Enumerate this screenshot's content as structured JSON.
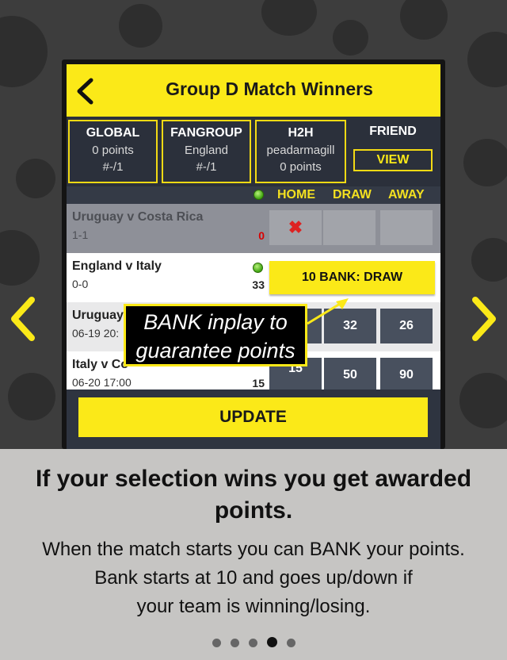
{
  "header": {
    "title": "Group D Match Winners"
  },
  "stats": [
    {
      "title": "GLOBAL",
      "line1": "0 points",
      "line2": "#-/1"
    },
    {
      "title": "FANGROUP",
      "line1": "England",
      "line2": "#-/1"
    },
    {
      "title": "H2H",
      "line1": "peadarmagill",
      "line2": "0 points"
    }
  ],
  "friend": {
    "title": "FRIEND",
    "view_label": "VIEW"
  },
  "columns": {
    "home": "HOME",
    "draw": "DRAW",
    "away": "AWAY"
  },
  "matches": [
    {
      "name": "Uruguay v Costa Rica",
      "sub": "1-1",
      "num": "0",
      "home_mark": "✖"
    },
    {
      "name": "England v Italy",
      "sub": "0-0",
      "num": "33",
      "bank_label": "10 BANK: DRAW"
    },
    {
      "name": "Uruguay",
      "sub": "06-19 20:",
      "draw": "32",
      "away": "26"
    },
    {
      "name": "Italy v Co",
      "sub": "06-20 17:00",
      "num": "15",
      "home": "15",
      "draw": "50",
      "away": "90"
    }
  ],
  "callout": {
    "line1": "BANK inplay to",
    "line2": "guarantee points"
  },
  "update_label": "UPDATE",
  "info": {
    "headline": "If your selection wins you get awarded points.",
    "body_line1": "When the match starts you can BANK your points.",
    "body_line2": "Bank starts at 10 and goes up/down if",
    "body_line3": "your team is winning/losing."
  },
  "pager": {
    "count": 5,
    "active_index": 3
  },
  "colors": {
    "accent": "#fbe918",
    "panel": "#2e3440",
    "info_bg": "#c6c5c3"
  }
}
